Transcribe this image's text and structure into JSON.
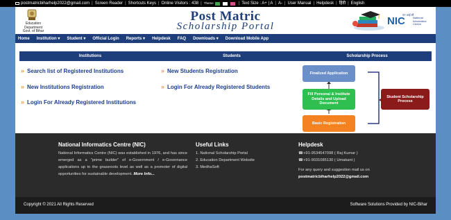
{
  "topbar": {
    "email": "postmatricbiharhelp2022@gmail.com",
    "screen_reader": "Screen Reader",
    "shortcut_keys": "Shortcuts Keys",
    "online_visitors": "Online Visitors : 438",
    "theme": "Theme",
    "theme_colors": [
      "#3fa34d",
      "#ffffff",
      "#d94c8a"
    ],
    "text_size": "Text Size : A+ | A",
    "text_smaller": "A-",
    "user_manual": "User Manual",
    "helpdesk": "Helpdesk",
    "hindi": "हिंदी",
    "english": "English"
  },
  "header": {
    "dept_line1": "Education Department",
    "dept_line2": "Govt. of Bihar",
    "title1": "Post Matric",
    "title2": "Scholarship Portal",
    "nic_hindi": "एन आई सी",
    "nic_name": "NIC",
    "nic_sub1": "National",
    "nic_sub2": "Informatics",
    "nic_sub3": "Centre"
  },
  "nav": [
    "Home",
    "Institution ▾",
    "Student ▾",
    "Official Login",
    "Reports ▾",
    "Helpdesk",
    "FAQ",
    "Downloads ▾",
    "Download Mobile App"
  ],
  "sections": {
    "institutions": {
      "heading": "Institutions",
      "links": [
        "Search list of Registered Institutions",
        "New Institutions Registration",
        "Login For Already Registered Institutions"
      ]
    },
    "students": {
      "heading": "Students",
      "links": [
        "New Students Registration",
        "Login For Already Registered Students"
      ]
    },
    "process": {
      "heading": "Scholarship Process",
      "steps": [
        "Finalized Application",
        "Fill Personal & Institute Details and Upload Document",
        "Basic Registration"
      ],
      "student_process": "Student Scholarship Process",
      "colors": {
        "finalized": "#6b8fc9",
        "fill": "#2fbf4f",
        "basic": "#f58220",
        "student": "#8b1a1a"
      }
    }
  },
  "footer": {
    "nic_title": "National Informatics Centre (NIC)",
    "nic_text": "National Informatics Centre (NIC) was established in 1976, and has since emerged as a \"prime builder\" of e-Government / e-Governance applications up to the grassroots level as well as a promoter of digital opportunities for sustainable development.",
    "more_info": "More Info...",
    "useful_title": "Useful Links",
    "useful_links": [
      "1. National Scholarship Portal",
      "2. Education Department Website",
      "3. MedhaSoft"
    ],
    "helpdesk_title": "Helpdesk",
    "phone1": "+91-9534547098 ( Raj Kumar )",
    "phone2": "+91-9031085130 ( Umakant )",
    "query_text": "For any query and suggestion mail us on",
    "mail": "postmatricbiharhelp2022@gmail.com"
  },
  "copyright": {
    "left": "Copyright © 2021 All Rights Reserved",
    "right": "Software Solutions Provided by NIC-Bihar"
  }
}
